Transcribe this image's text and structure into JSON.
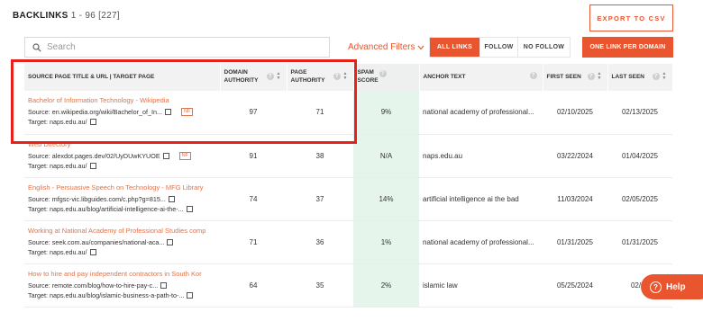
{
  "header": {
    "title": "BACKLINKS",
    "range": "1 - 96 [227]",
    "export_label": "EXPORT TO CSV"
  },
  "search": {
    "placeholder": "Search"
  },
  "filters": {
    "advanced_label": "Advanced Filters",
    "tabs": [
      {
        "label": "ALL LINKS",
        "active": true
      },
      {
        "label": "FOLLOW",
        "active": false
      },
      {
        "label": "NO FOLLOW",
        "active": false
      }
    ],
    "one_link_label": "ONE LINK PER DOMAIN"
  },
  "table": {
    "columns": [
      {
        "label": "SOURCE PAGE TITLE & URL | TARGET PAGE"
      },
      {
        "label": "DOMAIN AUTHORITY"
      },
      {
        "label": "PAGE AUTHORITY"
      },
      {
        "label": "SPAM SCORE"
      },
      {
        "label": "ANCHOR TEXT"
      },
      {
        "label": "FIRST SEEN"
      },
      {
        "label": "LAST SEEN"
      }
    ],
    "rows": [
      {
        "title": "Bachelor of Information Technology - Wikipedia",
        "source": "Source: en.wikipedia.org/wiki/Bachelor_of_In...",
        "target": "Target: naps.edu.au/",
        "nofollow": "NF",
        "domain_authority": "97",
        "page_authority": "71",
        "spam_score": "9%",
        "anchor": "national academy of professional...",
        "first_seen": "02/10/2025",
        "last_seen": "02/13/2025"
      },
      {
        "title": "Web Directory",
        "source": "Source: alexdot.pages.dev/02/UyDUwKYUOE",
        "target": "Target: naps.edu.au/",
        "nofollow": "NF",
        "domain_authority": "91",
        "page_authority": "38",
        "spam_score": "N/A",
        "anchor": "naps.edu.au",
        "first_seen": "03/22/2024",
        "last_seen": "01/04/2025"
      },
      {
        "title": "English - Persuasive Speech on Technology - MFG Library",
        "source": "Source: mfgsc-vic.libguides.com/c.php?g=815...",
        "target": "Target: naps.edu.au/blog/artificial-intelligence-ai-the-...",
        "nofollow": "",
        "domain_authority": "74",
        "page_authority": "37",
        "spam_score": "14%",
        "anchor": "artificial intelligence ai the bad",
        "first_seen": "11/03/2024",
        "last_seen": "02/05/2025"
      },
      {
        "title": "Working at National Academy of Professional Studies comp",
        "source": "Source: seek.com.au/companies/national-aca...",
        "target": "Target: naps.edu.au/",
        "nofollow": "",
        "domain_authority": "71",
        "page_authority": "36",
        "spam_score": "1%",
        "anchor": "national academy of professional...",
        "first_seen": "01/31/2025",
        "last_seen": "01/31/2025"
      },
      {
        "title": "How to hire and pay independent contractors in South Kor",
        "source": "Source: remote.com/blog/how-to-hire-pay-c...",
        "target": "Target: naps.edu.au/blog/islamic-business-a-path-to-...",
        "nofollow": "",
        "domain_authority": "64",
        "page_authority": "35",
        "spam_score": "2%",
        "anchor": "islamic law",
        "first_seen": "05/25/2024",
        "last_seen": "02/27"
      }
    ]
  },
  "help": {
    "label": "Help"
  },
  "colors": {
    "accent": "#e8552f",
    "highlight_box": "#e8221b",
    "spam_column_bg": "#e6f5ec",
    "link_title": "#e0734a"
  }
}
